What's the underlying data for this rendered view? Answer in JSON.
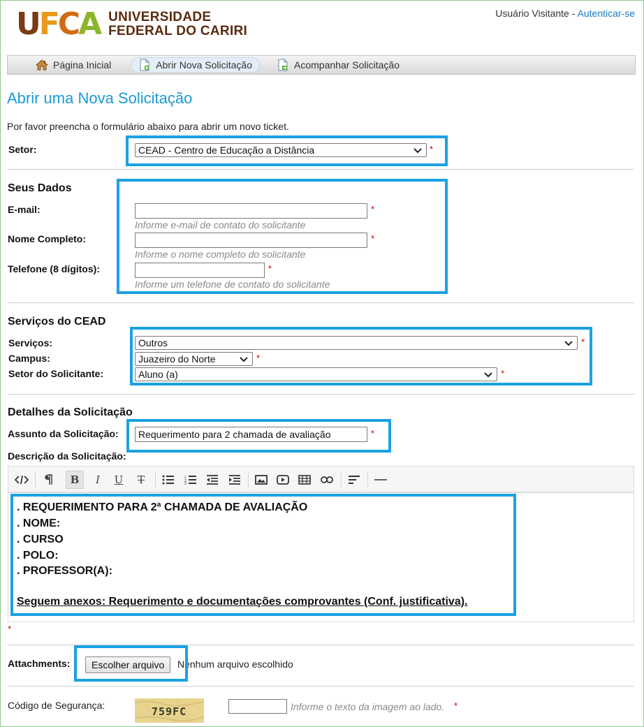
{
  "header": {
    "logo_mark": "UFCA",
    "logo_line1": "UNIVERSIDADE",
    "logo_line2": "FEDERAL DO CARIRI",
    "user_text": "Usuário Visitante - ",
    "login_link": "Autenticar-se"
  },
  "nav": {
    "items": [
      {
        "label": "Página Inicial",
        "icon": "home-icon"
      },
      {
        "label": "Abrir Nova Solicitação",
        "icon": "new-ticket-icon",
        "active": true
      },
      {
        "label": "Acompanhar Solicitação",
        "icon": "track-ticket-icon"
      }
    ]
  },
  "page": {
    "title": "Abrir uma Nova Solicitação",
    "intro": "Por favor preencha o formulário abaixo para abrir um novo ticket."
  },
  "setor": {
    "label": "Setor:",
    "value": "CEAD - Centro de Educação a Distância"
  },
  "seus_dados": {
    "heading": "Seus Dados",
    "email_label": "E-mail:",
    "email_value": "",
    "email_hint": "Informe e-mail de contato do solicitante",
    "nome_label": "Nome Completo:",
    "nome_value": "",
    "nome_hint": "Informe o nome completo do solicitante",
    "telefone_label": "Telefone (8 dígitos):",
    "telefone_value": "",
    "telefone_hint": "Informe um telefone de contato do solicitante"
  },
  "servicos": {
    "heading": "Serviços do CEAD",
    "servicos_label": "Serviços:",
    "servicos_value": "Outros",
    "campus_label": "Campus:",
    "campus_value": "Juazeiro do Norte",
    "setor_sol_label": "Setor do Solicitante:",
    "setor_sol_value": "Aluno (a)"
  },
  "detalhes": {
    "heading": "Detalhes da Solicitação",
    "assunto_label": "Assunto da Solicitação:",
    "assunto_value": "Requerimento para 2 chamada de avaliação",
    "descricao_label": "Descrição da Solicitação:",
    "editor_lines": [
      ". REQUERIMENTO PARA 2ª CHAMADA DE AVALIAÇÃO",
      ". NOME:",
      ". CURSO",
      ". POLO:",
      ". PROFESSOR(A):",
      "Seguem anexos: Requerimento e documentações comprovantes (Conf. justificativa)."
    ]
  },
  "attachments": {
    "label": "Attachments:",
    "button": "Escolher arquivo",
    "status": "Nenhum arquivo escolhido"
  },
  "seguranca": {
    "label": "Código de Segurança:",
    "captcha_text": "759FC",
    "input_value": "",
    "hint": "Informe o texto da imagem ao lado."
  },
  "required_mark": "*",
  "colors": {
    "accent": "#1a9ad6",
    "highlight": "#1ba1e2",
    "required": "#d00000"
  }
}
